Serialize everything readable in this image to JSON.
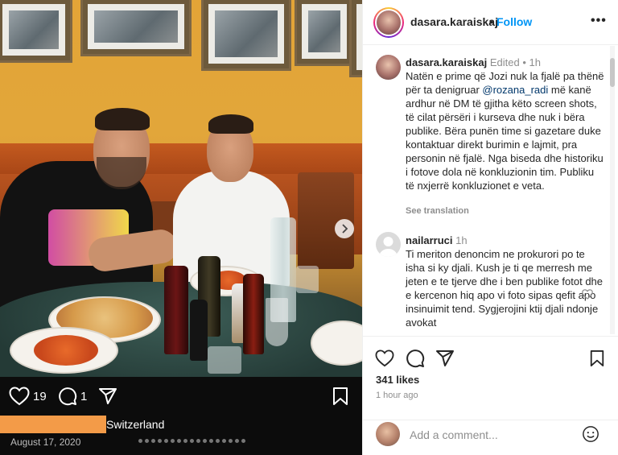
{
  "post": {
    "likes_count": "19",
    "comments_count": "1",
    "location": "Switzerland",
    "date": "August 17, 2020"
  },
  "header": {
    "username": "dasara.karaiskaj",
    "separator": "•",
    "follow_label": "Follow",
    "more_label": "•••"
  },
  "caption": {
    "username": "dasara.karaiskaj",
    "edited": "Edited",
    "time": "1h",
    "text_before": "Natën e prime që Jozi nuk la fjalë pa thënë për ta denigruar ",
    "mention": "@rozana_radi",
    "text_after": " më kanë ardhur në DM të gjitha këto screen shots, të cilat përsëri i kurseva dhe nuk i bëra publike. Bëra punën time si gazetare duke kontaktuar direkt burimin e lajmit, pra personin në fjalë. Nga biseda dhe historiku i fotove dola në konkluzionin tim. Publiku të nxjerrë konkluzionet e veta.",
    "see_translation": "See translation"
  },
  "comment": {
    "username": "nailarruci",
    "time": "1h",
    "text": "Ti meriton denoncim ne prokurori po te isha si ky djali. Kush je ti qe merresh me jeten e te tjerve dhe i ben publike fotot dhe e kercenon hiq apo vi foto sipas qefit apo insinuimit tend. Sygjerojini ktij djali ndonje avokat"
  },
  "actions": {
    "likes_text": "341 likes",
    "time_ago": "1 hour ago"
  },
  "comment_input": {
    "placeholder": "Add a comment..."
  },
  "icons": {
    "header_more": "more-horizontal-icon",
    "like": "heart-icon",
    "comment": "comment-bubble-icon",
    "share": "paper-plane-icon",
    "save": "bookmark-icon",
    "emoji": "smiley-icon",
    "next": "chevron-right-icon"
  },
  "colors": {
    "follow": "#0095f6",
    "mention": "#00376b",
    "location_redaction": "#f39b48"
  }
}
